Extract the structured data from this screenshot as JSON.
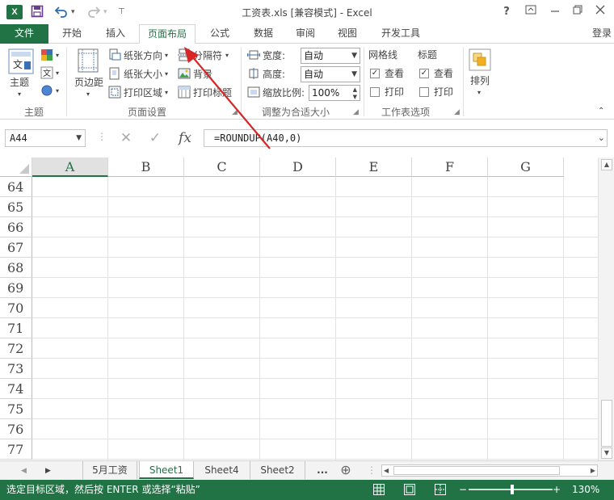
{
  "window": {
    "logo": "X",
    "title": "工资表.xls  [兼容模式] - Excel",
    "help": "?",
    "signin": "登录"
  },
  "ribbon_tabs": [
    "文件",
    "开始",
    "插入",
    "页面布局",
    "公式",
    "数据",
    "审阅",
    "视图",
    "开发工具"
  ],
  "active_tab": "页面布局",
  "ribbon": {
    "themes": {
      "label": "主题",
      "group": "主题"
    },
    "page_setup": {
      "margins": "页边距",
      "orientation": "纸张方向",
      "size": "纸张大小",
      "print_area": "打印区域",
      "breaks": "分隔符",
      "background": "背景",
      "print_titles": "打印标题",
      "group": "页面设置"
    },
    "scale_to_fit": {
      "width_label": "宽度:",
      "width_value": "自动",
      "height_label": "高度:",
      "height_value": "自动",
      "scale_label": "缩放比例:",
      "scale_value": "100%",
      "group": "调整为合适大小"
    },
    "sheet_options": {
      "gridlines": "网格线",
      "headings": "标题",
      "view": "查看",
      "print": "打印",
      "group": "工作表选项"
    },
    "arrange": {
      "label": "排列"
    }
  },
  "formula_bar": {
    "name_box": "A44",
    "cancel": "✕",
    "enter": "✓",
    "fx": "fx",
    "formula": "=ROUNDUP(A40,0)"
  },
  "grid": {
    "columns": [
      "A",
      "B",
      "C",
      "D",
      "E",
      "F",
      "G"
    ],
    "selected_column": "A",
    "rows": [
      "64",
      "65",
      "66",
      "67",
      "68",
      "69",
      "70",
      "71",
      "72",
      "73",
      "74",
      "75",
      "76",
      "77"
    ]
  },
  "sheets": {
    "tabs": [
      "5月工资",
      "Sheet1",
      "Sheet4",
      "Sheet2"
    ],
    "active": "Sheet1",
    "more": "...",
    "add": "⊕"
  },
  "status": {
    "message": "选定目标区域，然后按 ENTER 或选择“粘贴”",
    "zoom_minus": "−",
    "zoom_plus": "+",
    "zoom_level": "130%"
  },
  "colors": {
    "accent": "#217346",
    "annotation_arrow": "#d62728"
  }
}
